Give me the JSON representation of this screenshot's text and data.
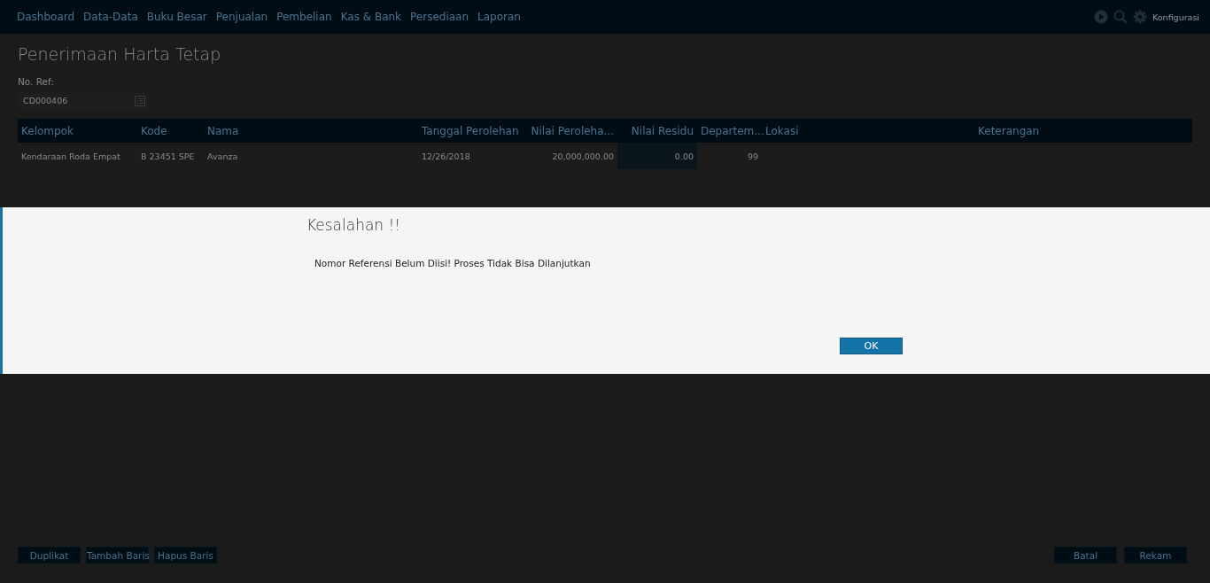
{
  "nav": {
    "items": [
      "Dashboard",
      "Data-Data",
      "Buku Besar",
      "Penjualan",
      "Pembelian",
      "Kas & Bank",
      "Persediaan",
      "Laporan"
    ],
    "config_label": "Konfigurasi"
  },
  "page": {
    "title": "Penerimaan Harta Tetap",
    "ref_label": "No. Ref:",
    "ref_value": "CD000406"
  },
  "table": {
    "columns": [
      "Kelompok",
      "Kode",
      "Nama",
      "Tanggal Perolehan",
      "Nilai Peroleha...",
      "Nilai Residu",
      "Departem...",
      "Lokasi",
      "Keterangan"
    ],
    "rows": [
      {
        "cells": [
          {
            "text": "Kendaraan Roda Empat",
            "selected": false
          },
          {
            "text": "B 23451 SPE",
            "selected": false
          },
          {
            "text": "Avanza",
            "selected": false
          },
          {
            "text": "12/26/2018",
            "selected": false
          },
          {
            "text": "20,000,000.00",
            "selected": false
          },
          {
            "text": "0.00",
            "selected": true
          },
          {
            "text": "99",
            "selected": false
          }
        ]
      }
    ]
  },
  "left_buttons": [
    "Duplikat",
    "Tambah Baris",
    "Hapus Baris"
  ],
  "right_buttons": [
    "Batal",
    "Rekam"
  ],
  "dialog": {
    "title": "Kesalahan !!",
    "message": "Nomor Referensi Belum Diisi! Proses Tidak Bisa Dilanjutkan",
    "button": "OK"
  }
}
